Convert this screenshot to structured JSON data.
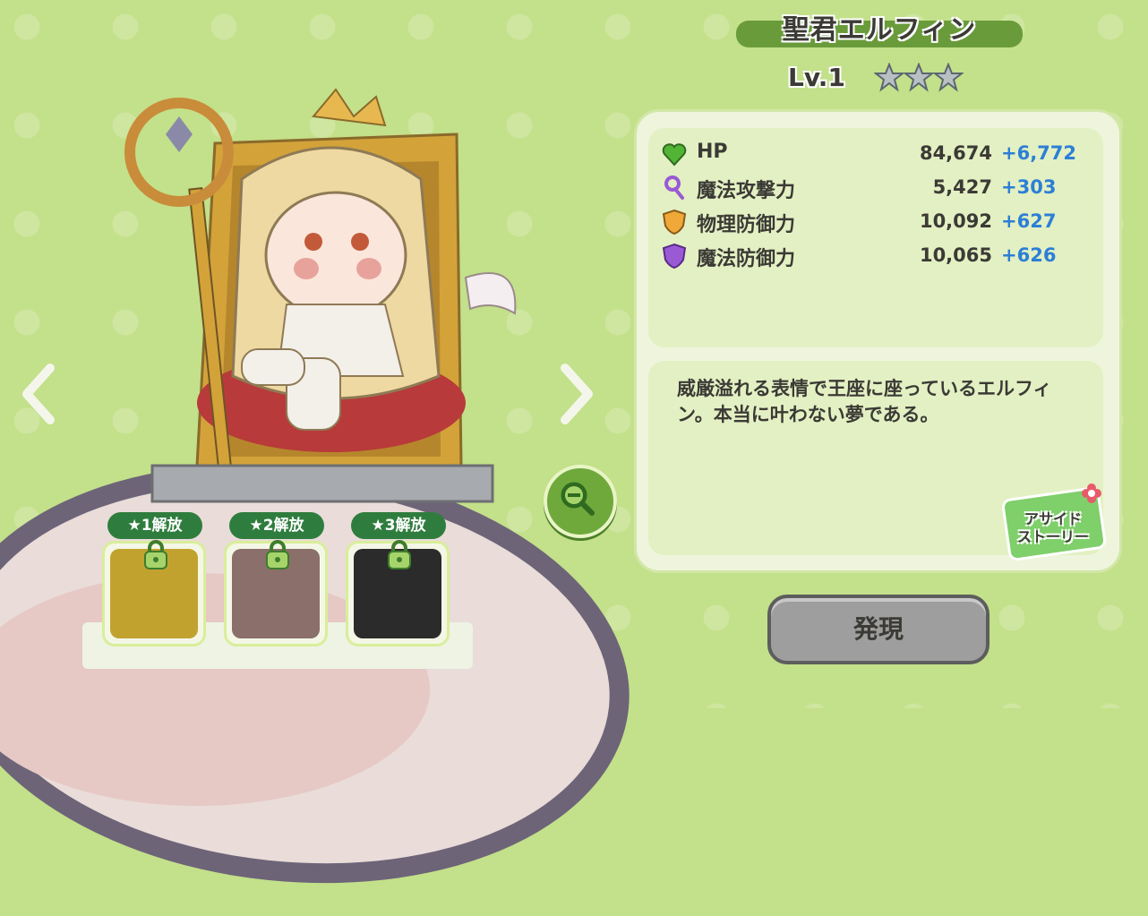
{
  "character": {
    "name": "聖君エルフィン",
    "level": "Lv.1",
    "stars_total": 3,
    "stars_filled": 0
  },
  "stats": [
    {
      "icon": "heart-icon",
      "label": "HP",
      "value": "84,674",
      "bonus": "+6,772"
    },
    {
      "icon": "magic-key-icon",
      "label": "魔法攻撃力",
      "value": "5,427",
      "bonus": "+303"
    },
    {
      "icon": "physical-shield-icon",
      "label": "物理防御力",
      "value": "10,092",
      "bonus": "+627"
    },
    {
      "icon": "magic-shield-icon",
      "label": "魔法防御力",
      "value": "10,065",
      "bonus": "+626"
    }
  ],
  "description": "威厳溢れる表情で王座に座っているエルフィン。本当に叶わない夢である。",
  "aside_story": {
    "line1": "アサイド",
    "line2": "ストーリー"
  },
  "manifest_button": "発現",
  "tiers": [
    {
      "label": "★1解放",
      "locked": true
    },
    {
      "label": "★2解放",
      "locked": true
    },
    {
      "label": "★3解放",
      "locked": true
    }
  ],
  "colors": {
    "background": "#c3e08a",
    "accent_green": "#6a9b3a",
    "bonus_blue": "#2c7fd6",
    "tier_label": "#2f7d3e",
    "button_gray": "#9e9e9e"
  }
}
